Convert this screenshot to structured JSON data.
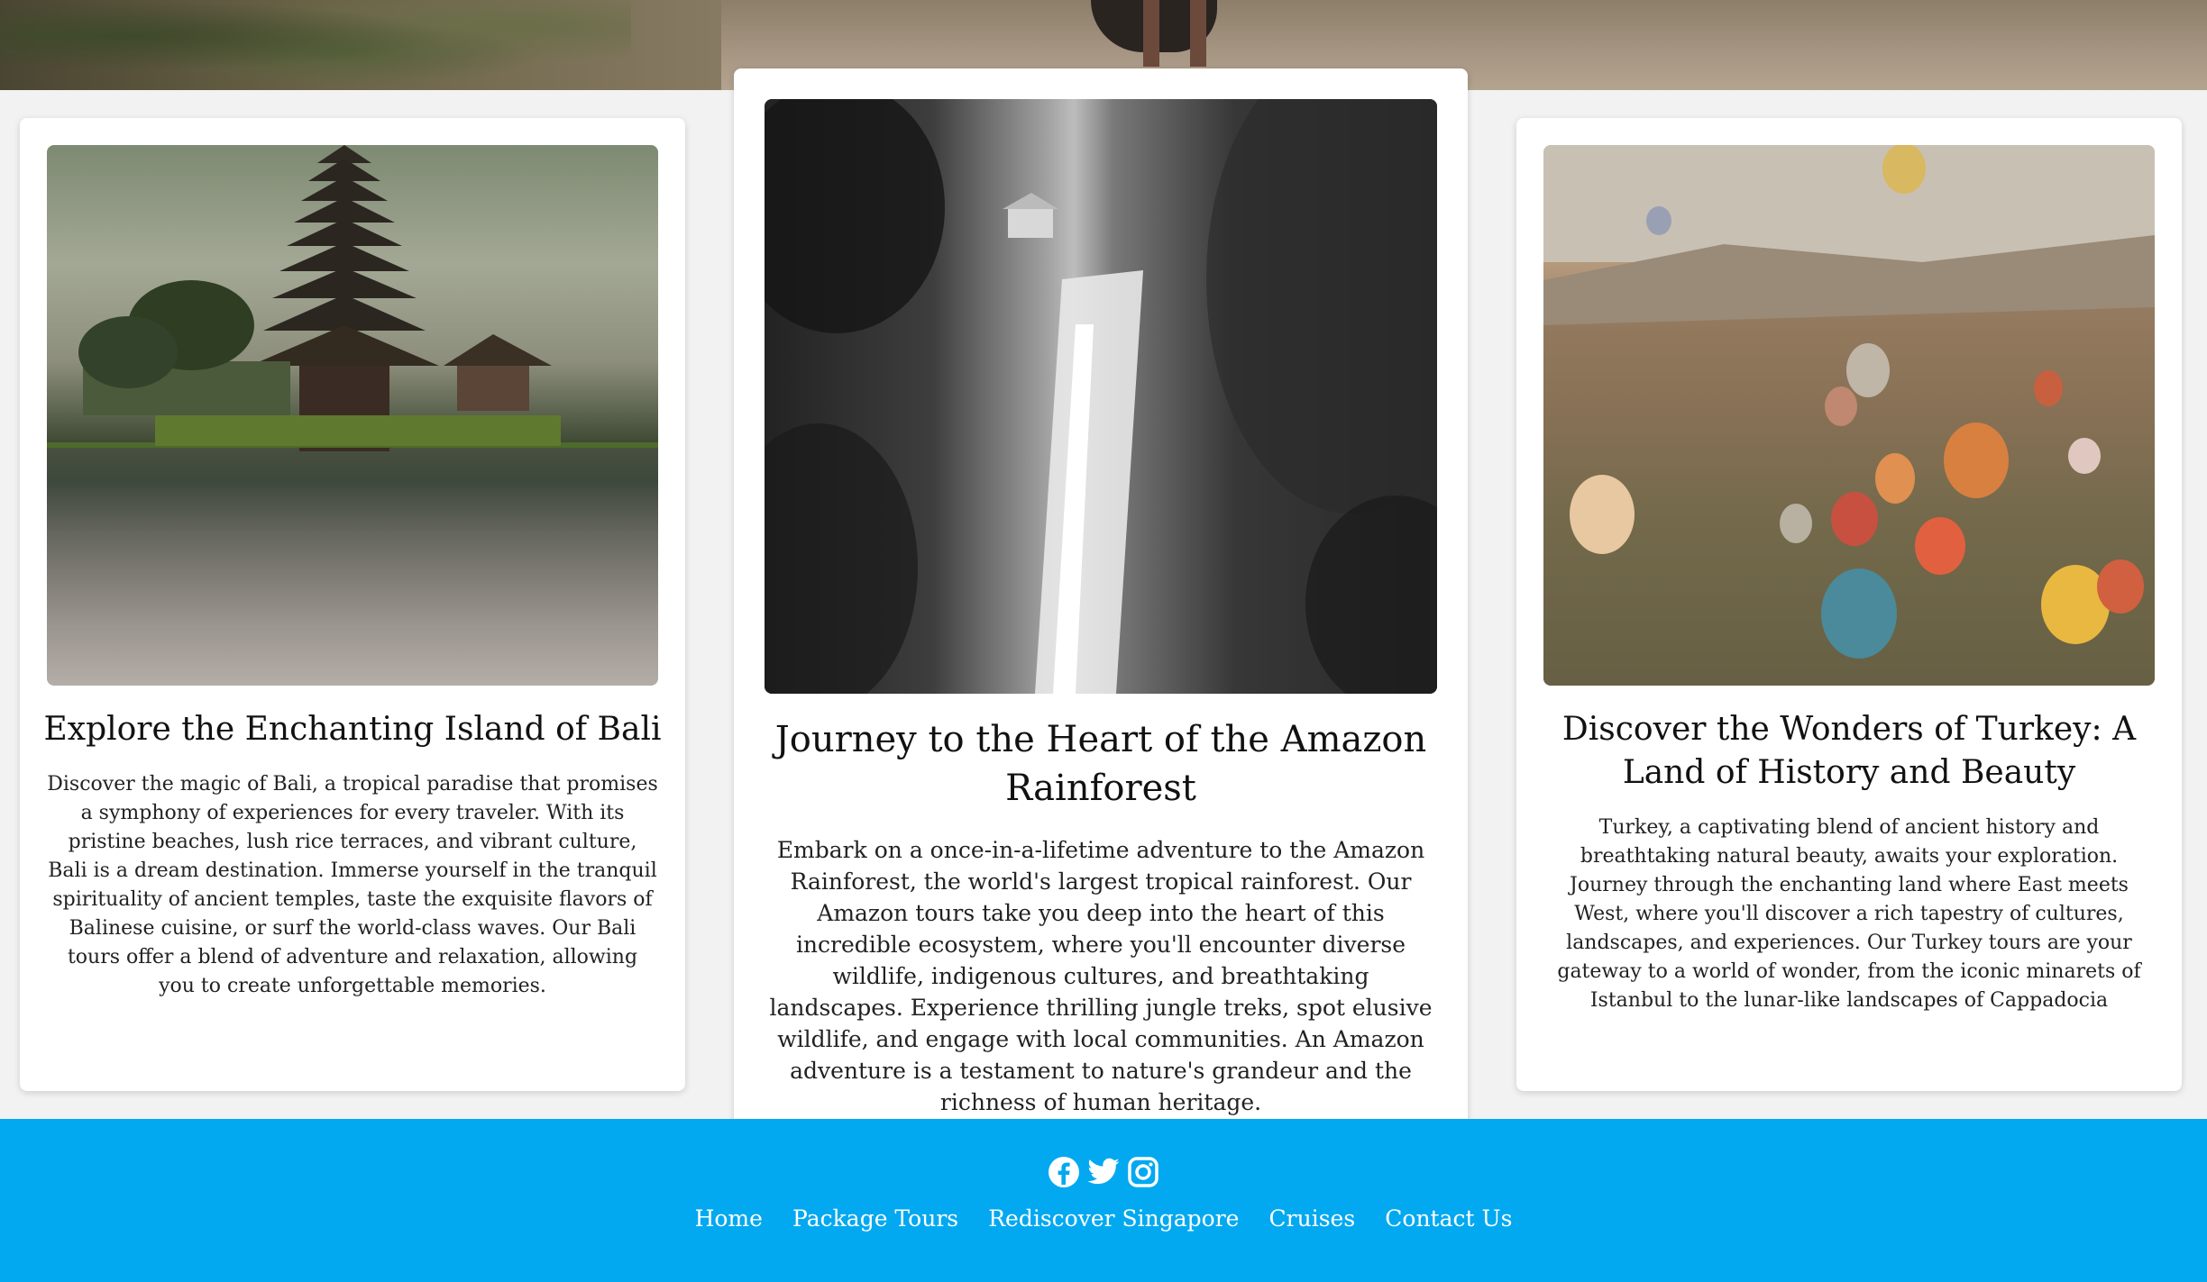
{
  "cards": [
    {
      "title": "Explore the Enchanting Island of Bali",
      "description": "Discover the magic of Bali, a tropical paradise that promises a symphony of experiences for every traveler. With its pristine beaches, lush rice terraces, and vibrant culture, Bali is a dream destination. Immerse yourself in the tranquil spirituality of ancient temples, taste the exquisite flavors of Balinese cuisine, or surf the world-class waves. Our Bali tours offer a blend of adventure and relaxation, allowing you to create unforgettable memories."
    },
    {
      "title": "Journey to the Heart of the Amazon Rainforest",
      "description": "Embark on a once-in-a-lifetime adventure to the Amazon Rainforest, the world's largest tropical rainforest. Our Amazon tours take you deep into the heart of this incredible ecosystem, where you'll encounter diverse wildlife, indigenous cultures, and breathtaking landscapes. Experience thrilling jungle treks, spot elusive wildlife, and engage with local communities. An Amazon adventure is a testament to nature's grandeur and the richness of human heritage."
    },
    {
      "title": "Discover the Wonders of Turkey: A Land of History and Beauty",
      "description": "Turkey, a captivating blend of ancient history and breathtaking natural beauty, awaits your exploration. Journey through the enchanting land where East meets West, where you'll discover a rich tapestry of cultures, landscapes, and experiences. Our Turkey tours are your gateway to a world of wonder, from the iconic minarets of Istanbul to the lunar-like landscapes of Cappadocia"
    }
  ],
  "footer": {
    "social": [
      "facebook-icon",
      "twitter-icon",
      "instagram-icon"
    ],
    "nav": [
      "Home",
      "Package Tours",
      "Rediscover Singapore",
      "Cruises",
      "Contact Us"
    ],
    "background": "#03a9f0"
  }
}
